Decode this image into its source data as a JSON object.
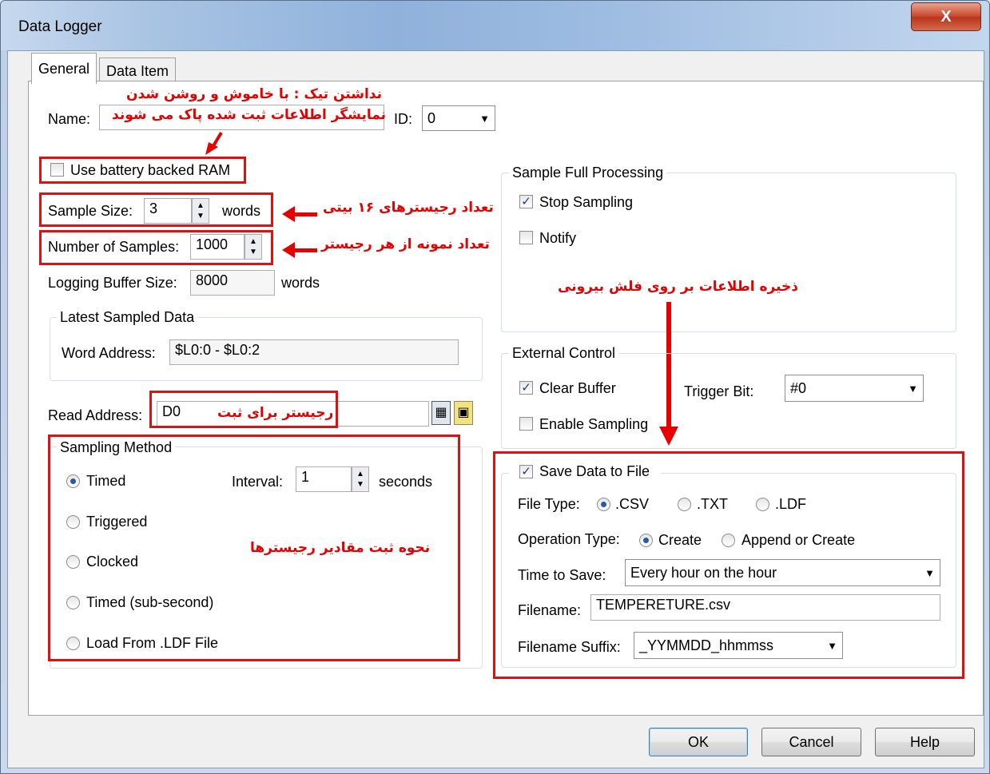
{
  "window": {
    "title": "Data Logger",
    "close_label": "X"
  },
  "tabs": [
    {
      "label": "General"
    },
    {
      "label": "Data Item"
    }
  ],
  "general": {
    "name_label": "Name:",
    "name_value": "",
    "id_label": "ID:",
    "id_value": "0",
    "battery_label": "Use battery backed RAM",
    "battery_checked": false,
    "sample_size_label": "Sample Size:",
    "sample_size_value": "3",
    "sample_size_unit": "words",
    "num_samples_label": "Number of Samples:",
    "num_samples_value": "1000",
    "buffer_label": "Logging Buffer Size:",
    "buffer_value": "8000",
    "buffer_unit": "words",
    "latest_group": "Latest Sampled Data",
    "word_address_label": "Word Address:",
    "word_address_value": "$L0:0 - $L0:2",
    "read_address_label": "Read Address:",
    "read_address_value": "D0"
  },
  "sampling": {
    "group": "Sampling Method",
    "interval_label": "Interval:",
    "interval_value": "1",
    "interval_unit": "seconds",
    "options": [
      "Timed",
      "Triggered",
      "Clocked",
      "Timed (sub-second)",
      "Load From .LDF File"
    ],
    "selected": "Timed"
  },
  "full_processing": {
    "group": "Sample Full Processing",
    "stop_label": "Stop Sampling",
    "stop_checked": true,
    "notify_label": "Notify",
    "notify_checked": false
  },
  "external": {
    "group": "External Control",
    "clear_label": "Clear Buffer",
    "clear_checked": true,
    "trigger_label": "Trigger Bit:",
    "trigger_value": "#0",
    "enable_label": "Enable Sampling",
    "enable_checked": false
  },
  "save": {
    "group": "Save Data to File",
    "checked": true,
    "file_type_label": "File Type:",
    "file_types": [
      ".CSV",
      ".TXT",
      ".LDF"
    ],
    "file_type_selected": ".CSV",
    "operation_label": "Operation Type:",
    "operations": [
      "Create",
      "Append or Create"
    ],
    "operation_selected": "Create",
    "time_label": "Time to Save:",
    "time_value": "Every hour on the hour",
    "filename_label": "Filename:",
    "filename_value": "TEMPERETURE.csv",
    "suffix_label": "Filename Suffix:",
    "suffix_value": "_YYMMDD_hhmmss"
  },
  "annotations": {
    "battery_line1": "نداشتن تیک : با خاموش و روشن شدن",
    "battery_line2": "نمایشگر اطلاعات ثبت شده پاک می شوند",
    "sample_size": "تعداد رجیسترهای ۱۶ بیتی",
    "num_samples": "تعداد نمونه از هر رجیستر",
    "flash": "ذخیره اطلاعات بر روی فلش بیرونی",
    "register": "رجیستر برای ثبت",
    "sampling": "نحوه ثبت مقادیر رجیسترها"
  },
  "buttons": {
    "ok": "OK",
    "cancel": "Cancel",
    "help": "Help"
  }
}
